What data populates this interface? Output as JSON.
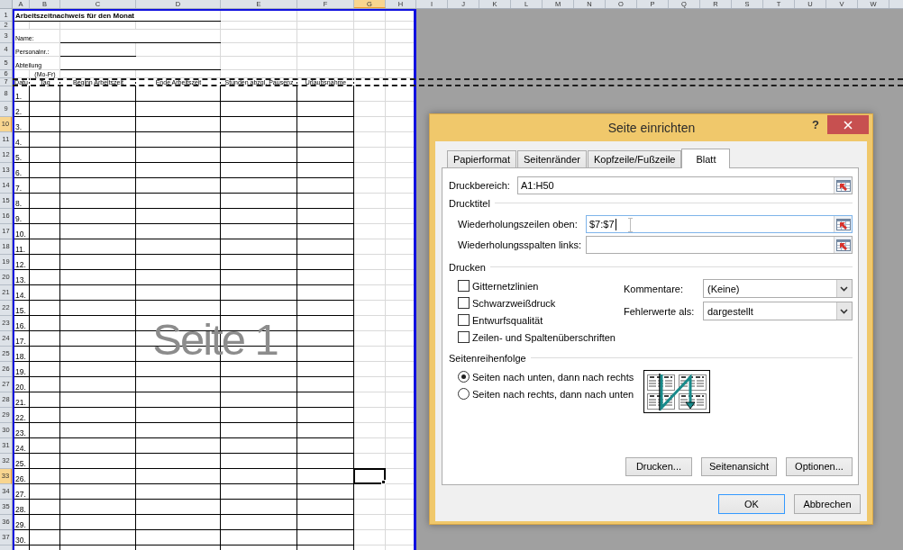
{
  "sheet": {
    "columns": [
      {
        "label": "A",
        "kind": "page",
        "selected": false
      },
      {
        "label": "B",
        "kind": "page",
        "selected": false
      },
      {
        "label": "C",
        "kind": "page",
        "selected": false
      },
      {
        "label": "D",
        "kind": "page",
        "selected": false
      },
      {
        "label": "E",
        "kind": "page",
        "selected": false
      },
      {
        "label": "F",
        "kind": "page",
        "selected": false
      },
      {
        "label": "G",
        "kind": "page",
        "selected": true
      },
      {
        "label": "H",
        "kind": "page",
        "selected": false
      },
      {
        "label": "I",
        "kind": "outside",
        "selected": false
      },
      {
        "label": "J",
        "kind": "outside",
        "selected": false
      },
      {
        "label": "K",
        "kind": "outside",
        "selected": false
      },
      {
        "label": "L",
        "kind": "outside",
        "selected": false
      },
      {
        "label": "M",
        "kind": "outside",
        "selected": false
      },
      {
        "label": "N",
        "kind": "outside",
        "selected": false
      },
      {
        "label": "O",
        "kind": "outside",
        "selected": false
      },
      {
        "label": "P",
        "kind": "outside",
        "selected": false
      },
      {
        "label": "Q",
        "kind": "outside",
        "selected": false
      },
      {
        "label": "R",
        "kind": "outside",
        "selected": false
      },
      {
        "label": "S",
        "kind": "outside",
        "selected": false
      },
      {
        "label": "T",
        "kind": "outside",
        "selected": false
      },
      {
        "label": "U",
        "kind": "outside",
        "selected": false
      },
      {
        "label": "V",
        "kind": "outside",
        "selected": false
      },
      {
        "label": "W",
        "kind": "outside",
        "selected": false
      }
    ],
    "row_headers": [
      {
        "label": "1",
        "selected": false
      },
      {
        "label": "2",
        "selected": false
      },
      {
        "label": "3",
        "selected": false
      },
      {
        "label": "4",
        "selected": false
      },
      {
        "label": "5",
        "selected": false
      },
      {
        "label": "6",
        "selected": false
      },
      {
        "label": "7",
        "selected": false
      },
      {
        "label": "8",
        "selected": false
      },
      {
        "label": "9",
        "selected": false
      },
      {
        "label": "10",
        "selected": true
      },
      {
        "label": "11",
        "selected": false
      },
      {
        "label": "12",
        "selected": false
      },
      {
        "label": "13",
        "selected": false
      },
      {
        "label": "14",
        "selected": false
      },
      {
        "label": "15",
        "selected": false
      },
      {
        "label": "16",
        "selected": false
      },
      {
        "label": "17",
        "selected": false
      },
      {
        "label": "18",
        "selected": false
      },
      {
        "label": "19",
        "selected": false
      },
      {
        "label": "20",
        "selected": false
      },
      {
        "label": "21",
        "selected": false
      },
      {
        "label": "22",
        "selected": false
      },
      {
        "label": "23",
        "selected": false
      },
      {
        "label": "24",
        "selected": false
      },
      {
        "label": "25",
        "selected": false
      },
      {
        "label": "26",
        "selected": false
      },
      {
        "label": "27",
        "selected": false
      },
      {
        "label": "28",
        "selected": false
      },
      {
        "label": "29",
        "selected": false
      },
      {
        "label": "30",
        "selected": false
      },
      {
        "label": "31",
        "selected": false
      },
      {
        "label": "32",
        "selected": false
      },
      {
        "label": "33",
        "selected": true
      },
      {
        "label": "34",
        "selected": false
      },
      {
        "label": "35",
        "selected": false
      },
      {
        "label": "36",
        "selected": false
      },
      {
        "label": "37",
        "selected": false
      }
    ],
    "title": "Arbeitszeitnachweis für den Monat",
    "form_fields": [
      {
        "label": "Name:",
        "kind": "long"
      },
      {
        "label": "Personalnr.:",
        "kind": "short"
      },
      {
        "label": "Abteilung",
        "kind": "long"
      }
    ],
    "weekday_note": "(Mo-Fr)",
    "table": {
      "marked": true,
      "columns": [
        "Datu",
        "Tag",
        "Beginn Arbeitszeit",
        "Ende Arbeitszeit",
        "Stunden abzgl. Pausenz",
        "Urlaubsnahme"
      ],
      "rows": [
        {
          "date": "1.",
          "active": false
        },
        {
          "date": "2.",
          "active": false
        },
        {
          "date": "3.",
          "active": false
        },
        {
          "date": "4.",
          "active": false
        },
        {
          "date": "5.",
          "active": false
        },
        {
          "date": "6.",
          "active": false
        },
        {
          "date": "7.",
          "active": false
        },
        {
          "date": "8.",
          "active": false
        },
        {
          "date": "9.",
          "active": false
        },
        {
          "date": "10.",
          "active": false
        },
        {
          "date": "11.",
          "active": false
        },
        {
          "date": "12.",
          "active": false
        },
        {
          "date": "13.",
          "active": false
        },
        {
          "date": "14.",
          "active": false
        },
        {
          "date": "15.",
          "active": false
        },
        {
          "date": "16.",
          "active": false
        },
        {
          "date": "17.",
          "active": false
        },
        {
          "date": "18.",
          "active": false
        },
        {
          "date": "19.",
          "active": false
        },
        {
          "date": "20.",
          "active": false
        },
        {
          "date": "21.",
          "active": false
        },
        {
          "date": "22.",
          "active": false
        },
        {
          "date": "23.",
          "active": false
        },
        {
          "date": "24.",
          "active": false
        },
        {
          "date": "25.",
          "active": false
        },
        {
          "date": "26.",
          "active": true
        },
        {
          "date": "27.",
          "active": false
        },
        {
          "date": "28.",
          "active": false
        },
        {
          "date": "29.",
          "active": false
        },
        {
          "date": "30.",
          "active": false
        }
      ]
    },
    "page_label": "Seite 1"
  },
  "dialog": {
    "title": "Seite einrichten",
    "help": "?",
    "tabs": [
      {
        "label": "Papierformat",
        "selected": false
      },
      {
        "label": "Seitenränder",
        "selected": false
      },
      {
        "label": "Kopfzeile/Fußzeile",
        "selected": false
      },
      {
        "label": "Blatt",
        "selected": true
      }
    ],
    "print_area": {
      "label": "Druckbereich:",
      "value": "A1:H50",
      "focused": false
    },
    "print_titles": {
      "heading": "Drucktitel",
      "fields": [
        {
          "label": "Wiederholungszeilen oben:",
          "value": "$7:$7",
          "focused": true
        },
        {
          "label": "Wiederholungsspalten links:",
          "focused": false
        }
      ]
    },
    "print": {
      "heading": "Drucken",
      "options": [
        {
          "label": "Gitternetzlinien",
          "checked": false
        },
        {
          "label": "Schwarzweißdruck",
          "checked": false
        },
        {
          "label": "Entwurfsqualität",
          "checked": false
        },
        {
          "label": "Zeilen- und Spaltenüberschriften",
          "checked": false
        }
      ],
      "dropdowns": [
        {
          "label": "Kommentare:",
          "value": "(Keine)"
        },
        {
          "label": "Fehlerwerte als:",
          "value": "dargestellt"
        }
      ]
    },
    "page_order": {
      "heading": "Seitenreihenfolge",
      "options": [
        {
          "label": "Seiten nach unten, dann nach rechts",
          "selected": true
        },
        {
          "label": "Seiten nach rechts, dann nach unten",
          "selected": false
        }
      ]
    },
    "panel_buttons": [
      "Drucken...",
      "Seitenansicht",
      "Optionen..."
    ],
    "buttons": [
      {
        "label": "OK",
        "default": true
      },
      {
        "label": "Abbrechen",
        "default": false
      }
    ]
  }
}
